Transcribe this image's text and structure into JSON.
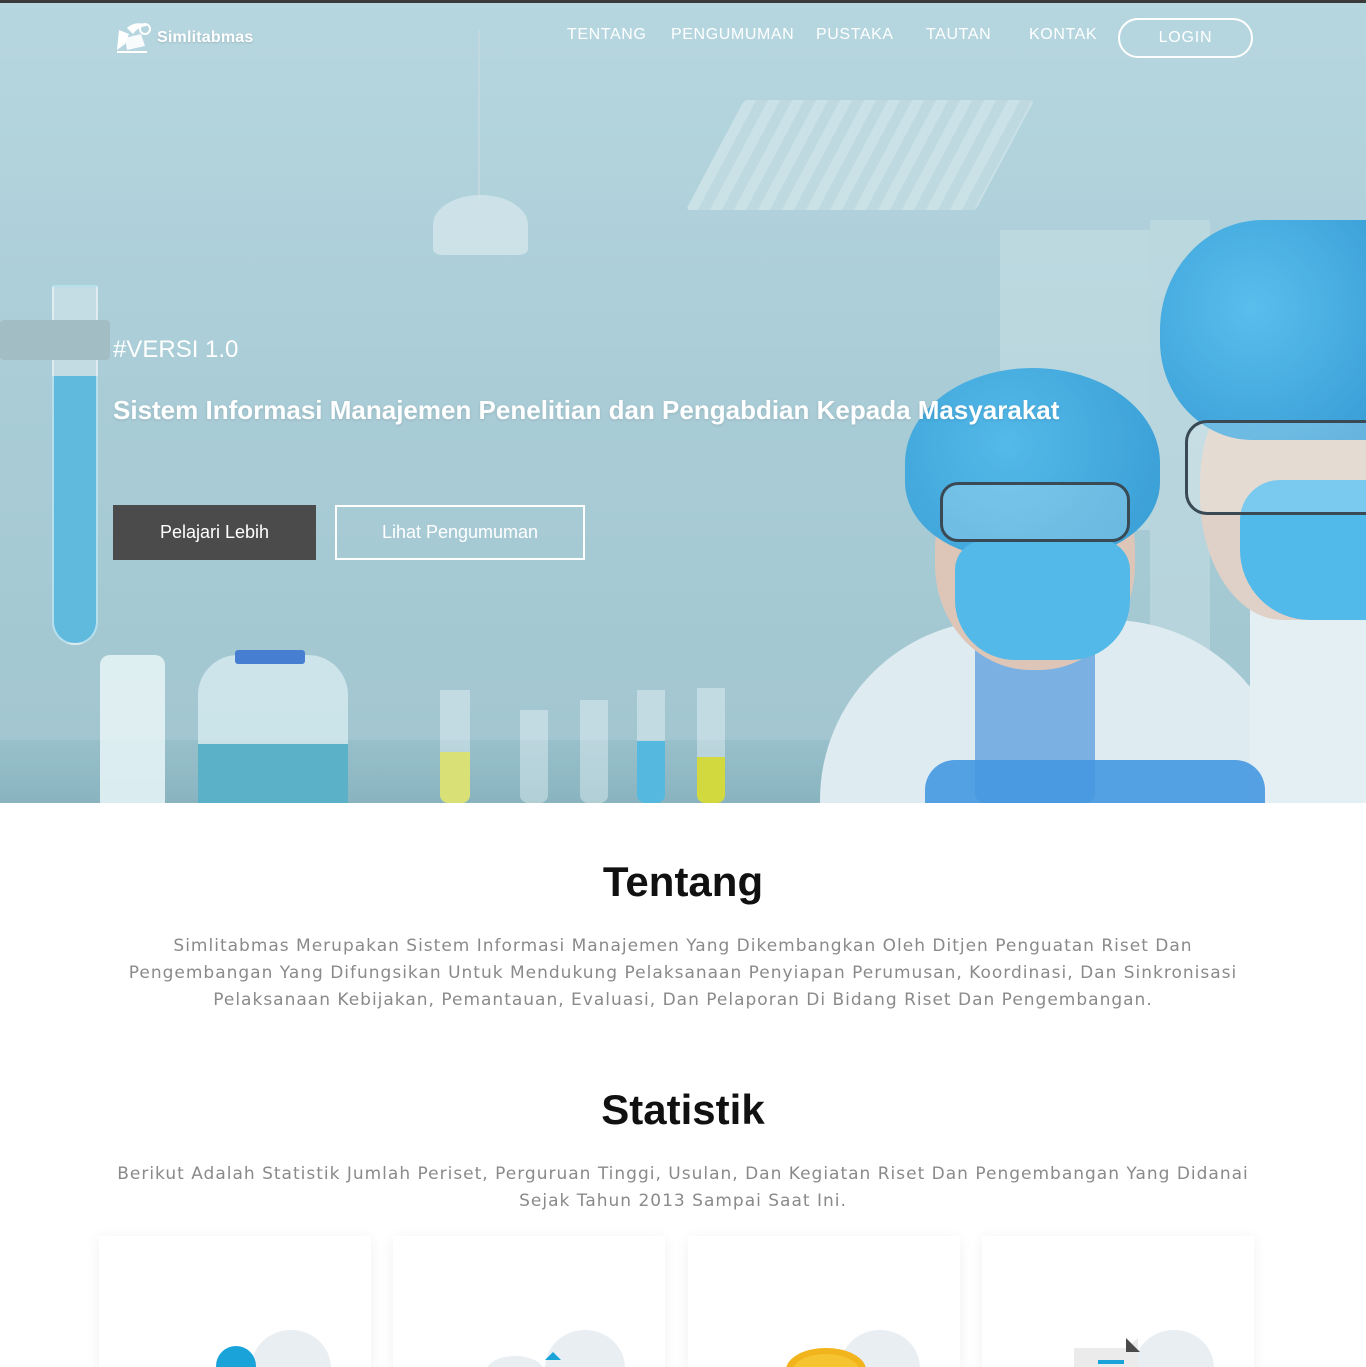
{
  "brand": {
    "name": "Simlitabmas"
  },
  "nav": {
    "items": [
      {
        "label": "TENTANG"
      },
      {
        "label": "PENGUMUMAN"
      },
      {
        "label": "PUSTAKA"
      },
      {
        "label": "TAUTAN"
      },
      {
        "label": "KONTAK"
      }
    ],
    "login_label": "LOGIN"
  },
  "hero": {
    "tag": "#VERSI 1.0",
    "title": "Sistem Informasi Manajemen Penelitian dan Pengabdian Kepada Masyarakat",
    "primary_button": "Pelajari Lebih",
    "secondary_button": "Lihat Pengumuman"
  },
  "about": {
    "title": "Tentang",
    "text": "Simlitabmas Merupakan Sistem Informasi Manajemen Yang Dikembangkan Oleh Ditjen Penguatan Riset Dan Pengembangan Yang Difungsikan Untuk Mendukung Pelaksanaan Penyiapan Perumusan, Koordinasi, Dan Sinkronisasi Pelaksanaan Kebijakan, Pemantauan, Evaluasi, Dan Pelaporan Di Bidang Riset Dan Pengembangan."
  },
  "stats": {
    "title": "Statistik",
    "text": "Berikut Adalah Statistik Jumlah Periset, Perguruan Tinggi, Usulan, Dan Kegiatan Riset Dan Pengembangan Yang Didanai Sejak Tahun 2013 Sampai Saat Ini.",
    "cards": [
      {
        "icon": "researcher-icon",
        "color": "#1aa3d9"
      },
      {
        "icon": "university-icon",
        "color": "#1aa3d9"
      },
      {
        "icon": "coin-icon",
        "color": "#f2b41c"
      },
      {
        "icon": "document-icon",
        "color": "#4a4a4a"
      }
    ]
  },
  "colors": {
    "primary_button": "#4b4b4b",
    "title_text": "#111111",
    "body_text": "#8a8a8a"
  }
}
